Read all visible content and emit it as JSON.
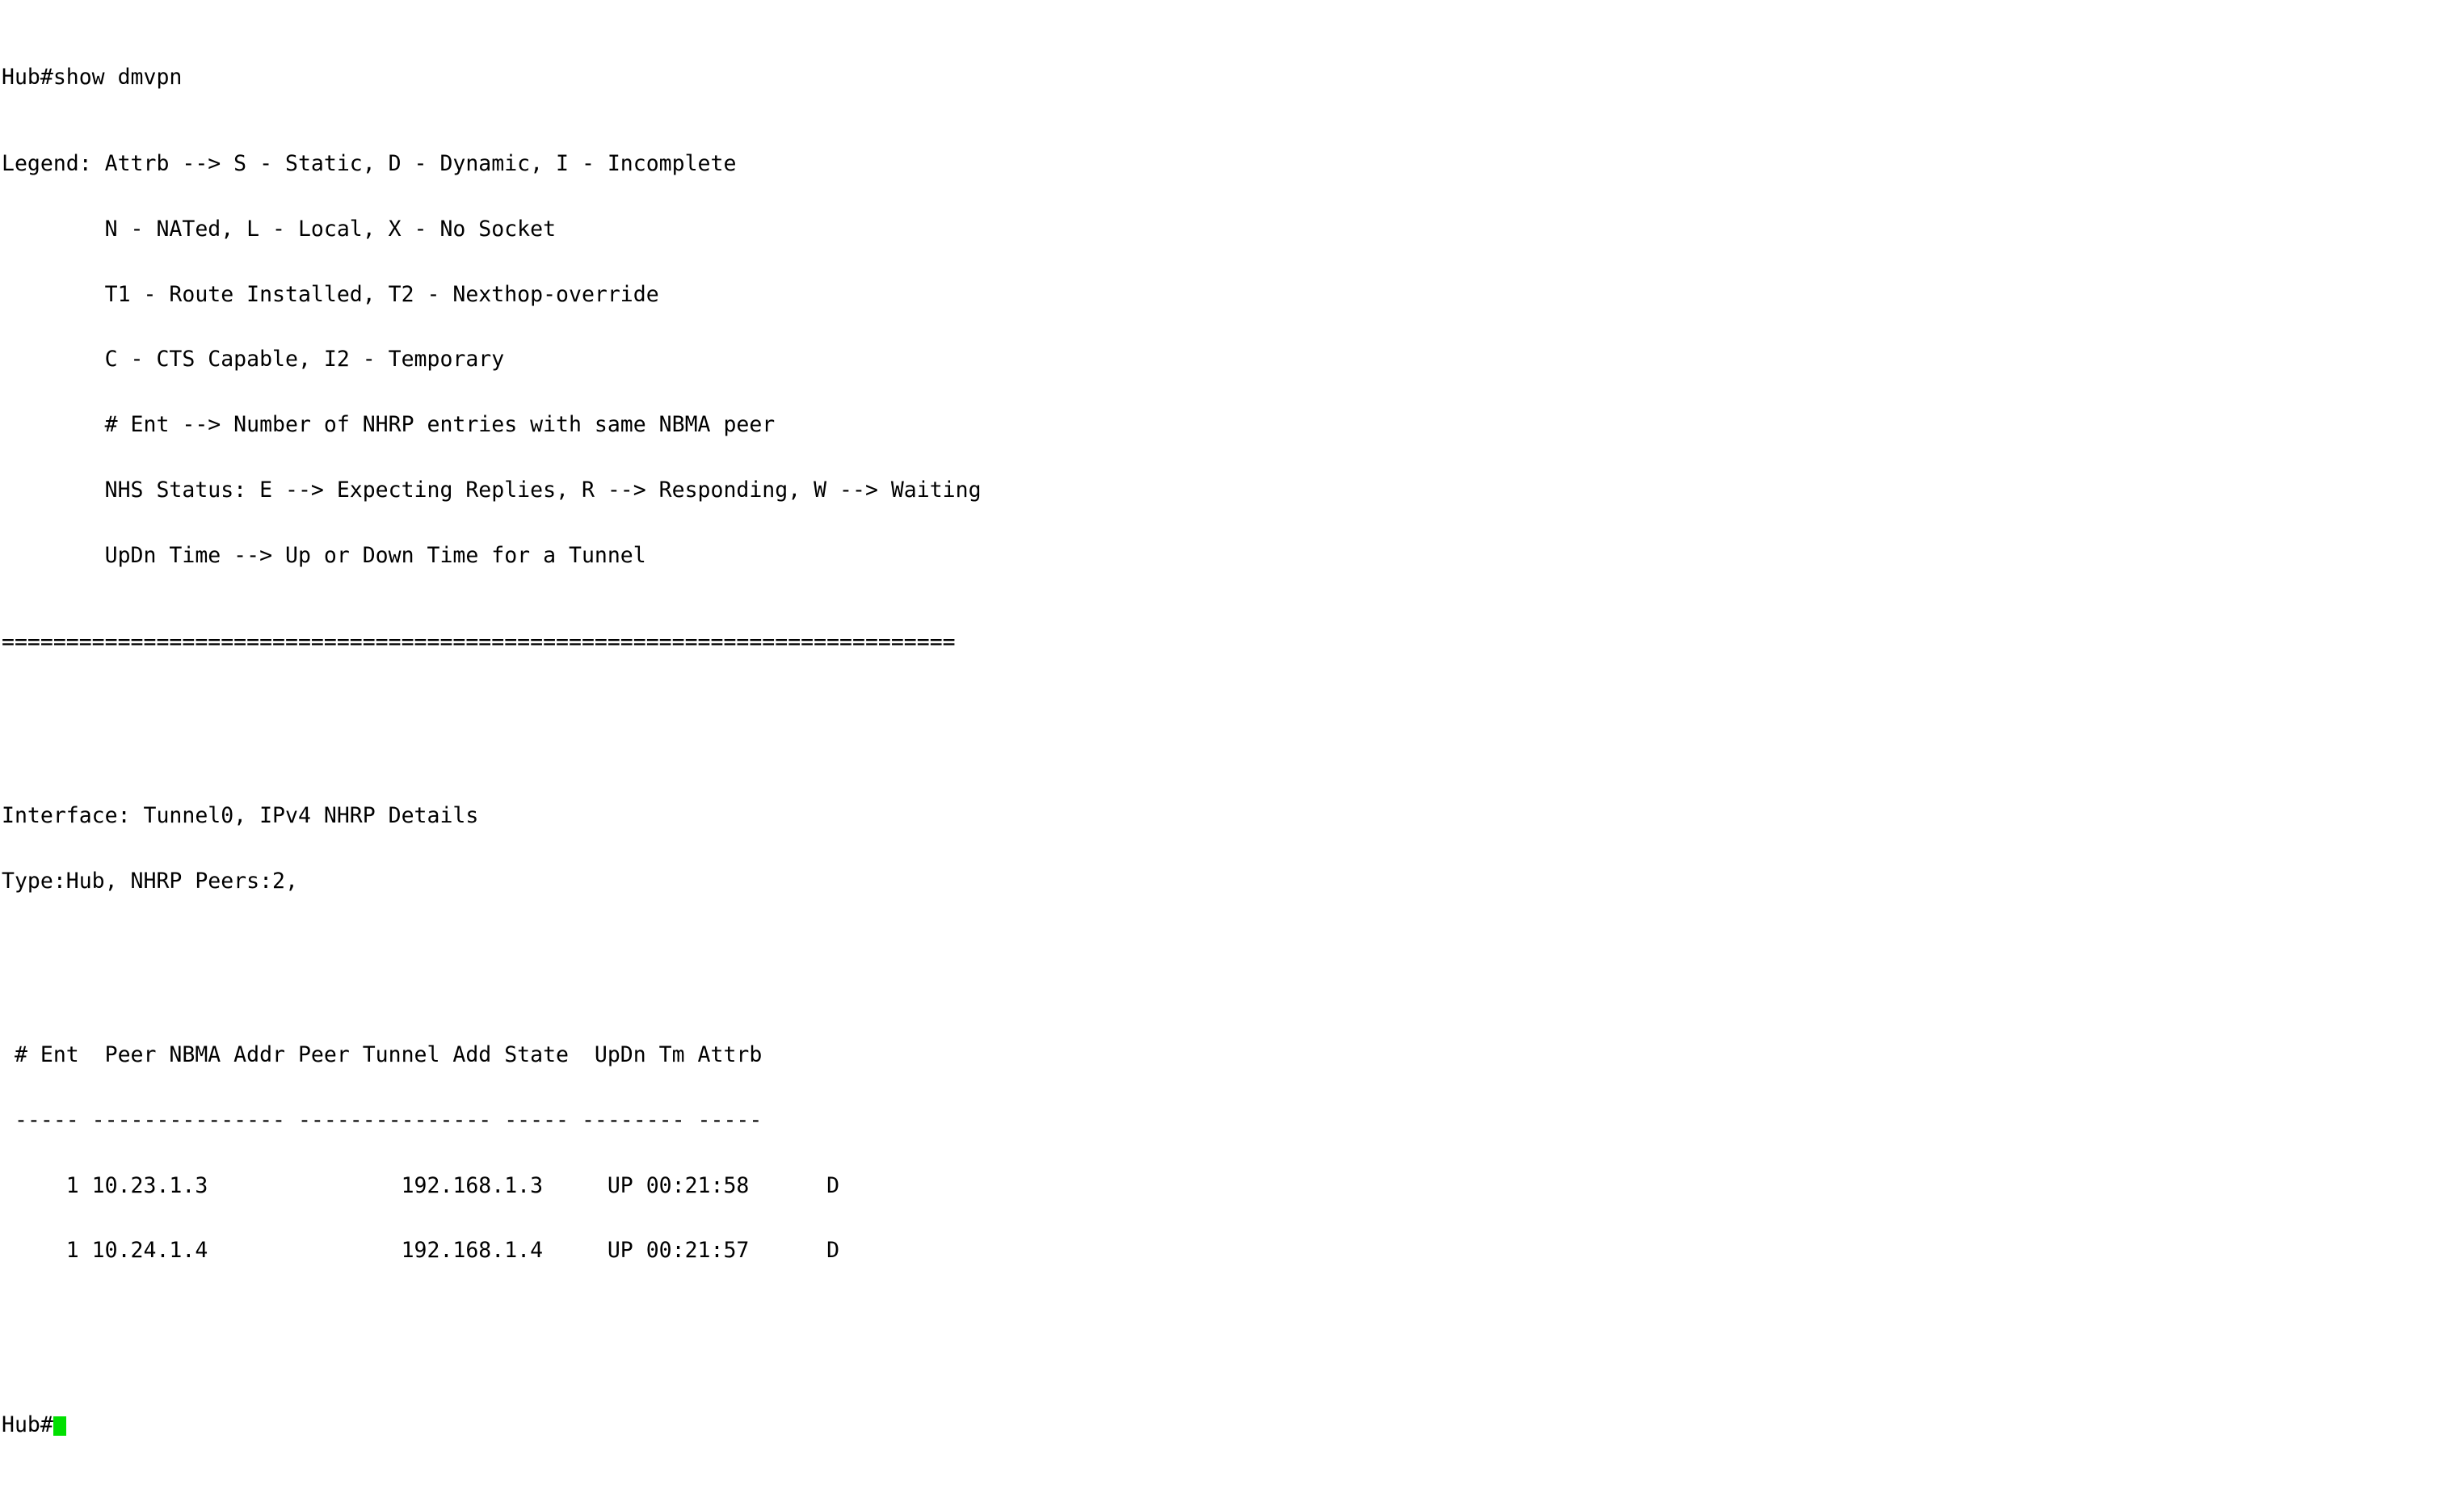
{
  "terminal": {
    "prompt": "Hub#",
    "command": "show dmvpn",
    "command_line": "Hub#show dmvpn",
    "cursor_color": "#00e000",
    "background_color": "#ffffff",
    "text_color": "#000000",
    "legend": {
      "label": "Legend:",
      "lines": [
        "Legend: Attrb --> S - Static, D - Dynamic, I - Incomplete",
        "        N - NATed, L - Local, X - No Socket",
        "        T1 - Route Installed, T2 - Nexthop-override",
        "        C - CTS Capable, I2 - Temporary",
        "        # Ent --> Number of NHRP entries with same NBMA peer",
        "        NHS Status: E --> Expecting Replies, R --> Responding, W --> Waiting",
        "        UpDn Time --> Up or Down Time for a Tunnel"
      ],
      "entries": [
        {
          "code": "S",
          "meaning": "Static"
        },
        {
          "code": "D",
          "meaning": "Dynamic"
        },
        {
          "code": "I",
          "meaning": "Incomplete"
        },
        {
          "code": "N",
          "meaning": "NATed"
        },
        {
          "code": "L",
          "meaning": "Local"
        },
        {
          "code": "X",
          "meaning": "No Socket"
        },
        {
          "code": "T1",
          "meaning": "Route Installed"
        },
        {
          "code": "T2",
          "meaning": "Nexthop-override"
        },
        {
          "code": "C",
          "meaning": "CTS Capable"
        },
        {
          "code": "I2",
          "meaning": "Temporary"
        },
        {
          "code": "E",
          "meaning": "Expecting Replies"
        },
        {
          "code": "R",
          "meaning": "Responding"
        },
        {
          "code": "W",
          "meaning": "Waiting"
        }
      ]
    },
    "separator": "==========================================================================",
    "interface_line": "Interface: Tunnel0, IPv4 NHRP Details",
    "type_line": "Type:Hub, NHRP Peers:2,",
    "interface": {
      "name": "Tunnel0",
      "protocol": "IPv4 NHRP Details",
      "type": "Hub",
      "nhrp_peers": "2"
    },
    "table": {
      "header_line": " # Ent  Peer NBMA Addr Peer Tunnel Add State  UpDn Tm Attrb",
      "divider_line": " ----- --------------- --------------- ----- -------- -----",
      "columns": [
        "# Ent",
        "Peer NBMA Addr",
        "Peer Tunnel Add",
        "State",
        "UpDn Tm",
        "Attrb"
      ],
      "rows": [
        {
          "line": "     1 10.23.1.3               192.168.1.3     UP 00:21:58      D",
          "ent": "1",
          "peer_nbma_addr": "10.23.1.3",
          "peer_tunnel_add": "192.168.1.3",
          "state": "UP",
          "updn_tm": "00:21:58",
          "attrb": "D"
        },
        {
          "line": "     1 10.24.1.4               192.168.1.4     UP 00:21:57      D",
          "ent": "1",
          "peer_nbma_addr": "10.24.1.4",
          "peer_tunnel_add": "192.168.1.4",
          "state": "UP",
          "updn_tm": "00:21:57",
          "attrb": "D"
        }
      ]
    },
    "final_prompt": "Hub#"
  }
}
